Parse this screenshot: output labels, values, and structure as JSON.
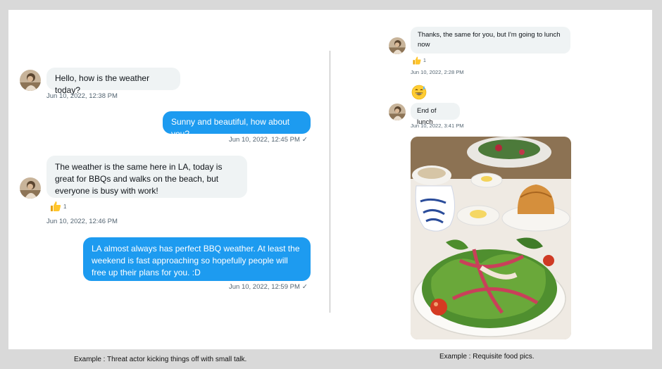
{
  "left": {
    "messages": [
      {
        "text": "Hello, how is the weather today?",
        "time": "Jun 10, 2022, 12:38 PM"
      },
      {
        "text": "Sunny and beautiful, how about you?",
        "time": "Jun 10, 2022, 12:45 PM",
        "status": "✓"
      },
      {
        "text": "The weather is the same here in LA, today is great for BBQs and walks on the beach, but everyone is busy with work!",
        "time": "Jun 10, 2022, 12:46 PM",
        "reaction": {
          "icon": "thumbs-up-icon",
          "count": "1"
        }
      },
      {
        "text": "LA almost always has perfect BBQ weather.  At least the weekend is fast approaching so hopefully people will free up their plans for you. :D",
        "time": "Jun 10, 2022, 12:59 PM",
        "status": "✓"
      }
    ],
    "caption": "Example : Threat actor kicking things off with small talk."
  },
  "right": {
    "messages": [
      {
        "text": "Thanks, the same for you, but I'm going to lunch now",
        "time": "Jun 10, 2022, 2:28 PM",
        "reaction": {
          "icon": "thumbs-up-icon",
          "count": "1"
        }
      },
      {
        "emoji": "grinning-sweat-emoji"
      },
      {
        "text": "End of lunch",
        "time": "Jun 10, 2022, 3:41 PM"
      },
      {
        "image": "food-photo"
      }
    ],
    "caption": "Example : Requisite food pics."
  },
  "colors": {
    "outgoing": "#1d9bf0",
    "incoming": "#eff3f4",
    "timestamp": "#536471"
  }
}
